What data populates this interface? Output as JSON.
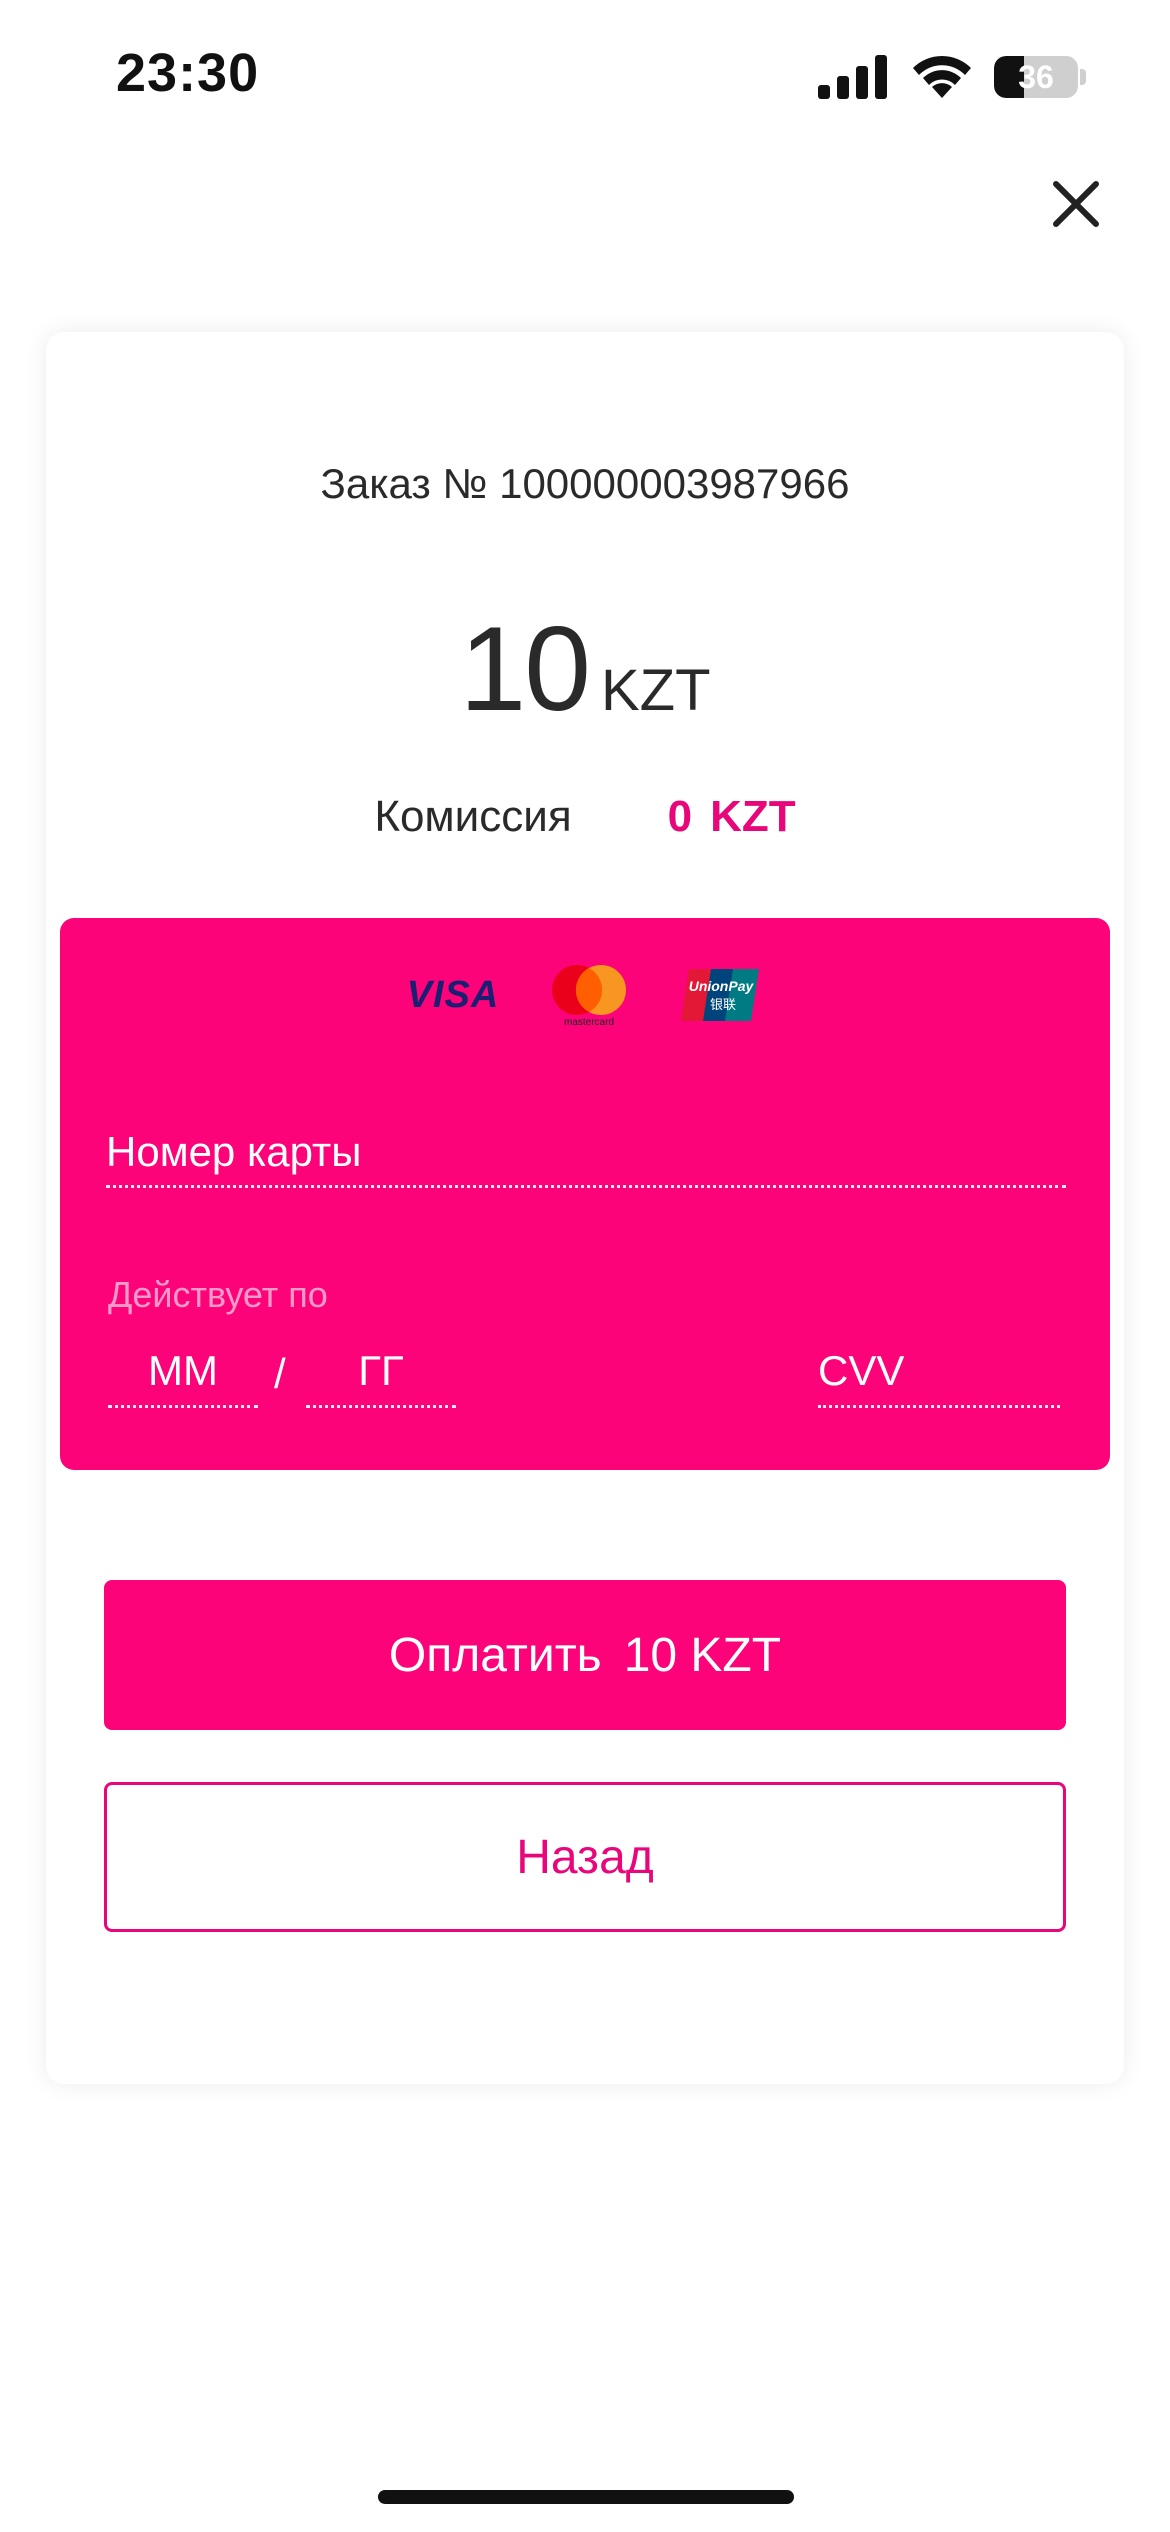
{
  "status_bar": {
    "time": "23:30",
    "battery_percent": 36,
    "battery_label": "36",
    "icons": [
      "cellular-signal-icon",
      "wifi-icon",
      "battery-icon"
    ]
  },
  "header": {
    "close_icon": "close-icon"
  },
  "order": {
    "title": "Заказ № 100000003987966",
    "amount_value": "10",
    "amount_currency": "KZT",
    "fee_label": "Комиссия",
    "fee_value": "0",
    "fee_currency": "KZT"
  },
  "card_form": {
    "logos": [
      "visa-logo",
      "mastercard-logo",
      "unionpay-logo"
    ],
    "visa_text": "VISA",
    "mastercard_text": "mastercard",
    "unionpay_text": "UnionPay",
    "unionpay_cn": "银联",
    "card_number_placeholder": "Номер карты",
    "valid_label": "Действует по",
    "month_placeholder": "ММ",
    "slash": "/",
    "year_placeholder": "ГГ",
    "cvv_placeholder": "CVV"
  },
  "actions": {
    "pay_label": "Оплатить",
    "pay_amount": "10 KZT",
    "back_label": "Назад"
  },
  "colors": {
    "accent": "#fc0379",
    "accent_text": "#e8077a",
    "text": "#2a2a2a"
  }
}
